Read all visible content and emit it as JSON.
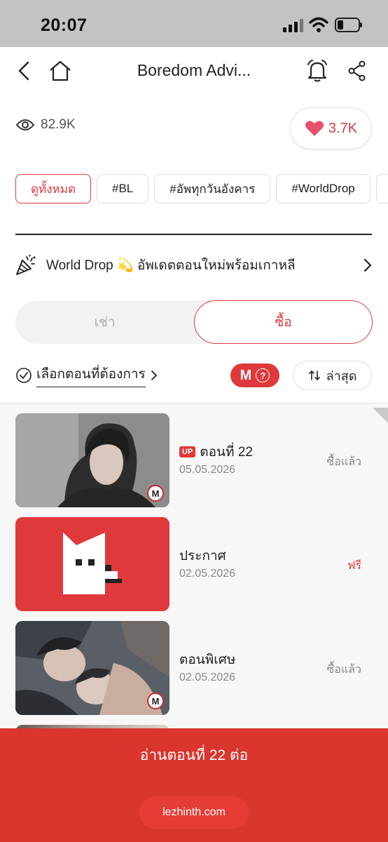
{
  "status_bar": {
    "time": "20:07"
  },
  "header": {
    "title": "Boredom Advi..."
  },
  "stats": {
    "views": "82.9K",
    "likes": "3.7K"
  },
  "tags": [
    "ดูทั้งหมด",
    "#BL",
    "#อัพทุกวันอังคาร",
    "#WorldDrop",
    ""
  ],
  "notice": {
    "text": "World Drop 💫 อัพเดตตอนใหม่พร้อมเกาหลี"
  },
  "purchase_mode": {
    "rent_label": "เช่า",
    "buy_label": "ซื้อ",
    "selected": "buy"
  },
  "episode_controls": {
    "select_label": "เลือกตอนที่ต้องการ",
    "m_badge": "M",
    "help": "?",
    "sort_label": "ล่าสุด"
  },
  "episodes": [
    {
      "up_badge": "UP",
      "name": "ตอนที่ 22",
      "date": "05.05.2026",
      "status": "ซื้อแล้ว",
      "m": "M"
    },
    {
      "name": "ประกาศ",
      "date": "02.05.2026",
      "status": "ฟรี"
    },
    {
      "name": "ตอนพิเศษ",
      "date": "02.05.2026",
      "status": "ซื้อแล้ว",
      "m": "M"
    }
  ],
  "bottom": {
    "continue_label": "อ่านตอนที่ 22 ต่อ",
    "url": "lezhinth.com"
  },
  "colors": {
    "accent": "#e0393b",
    "bottom_bar": "#db352f"
  },
  "icons": [
    "back-icon",
    "home-icon",
    "bell-icon",
    "share-icon",
    "eye-icon",
    "heart-icon",
    "party-icon",
    "chevron-right-icon",
    "check-circle-icon",
    "sort-icon"
  ]
}
